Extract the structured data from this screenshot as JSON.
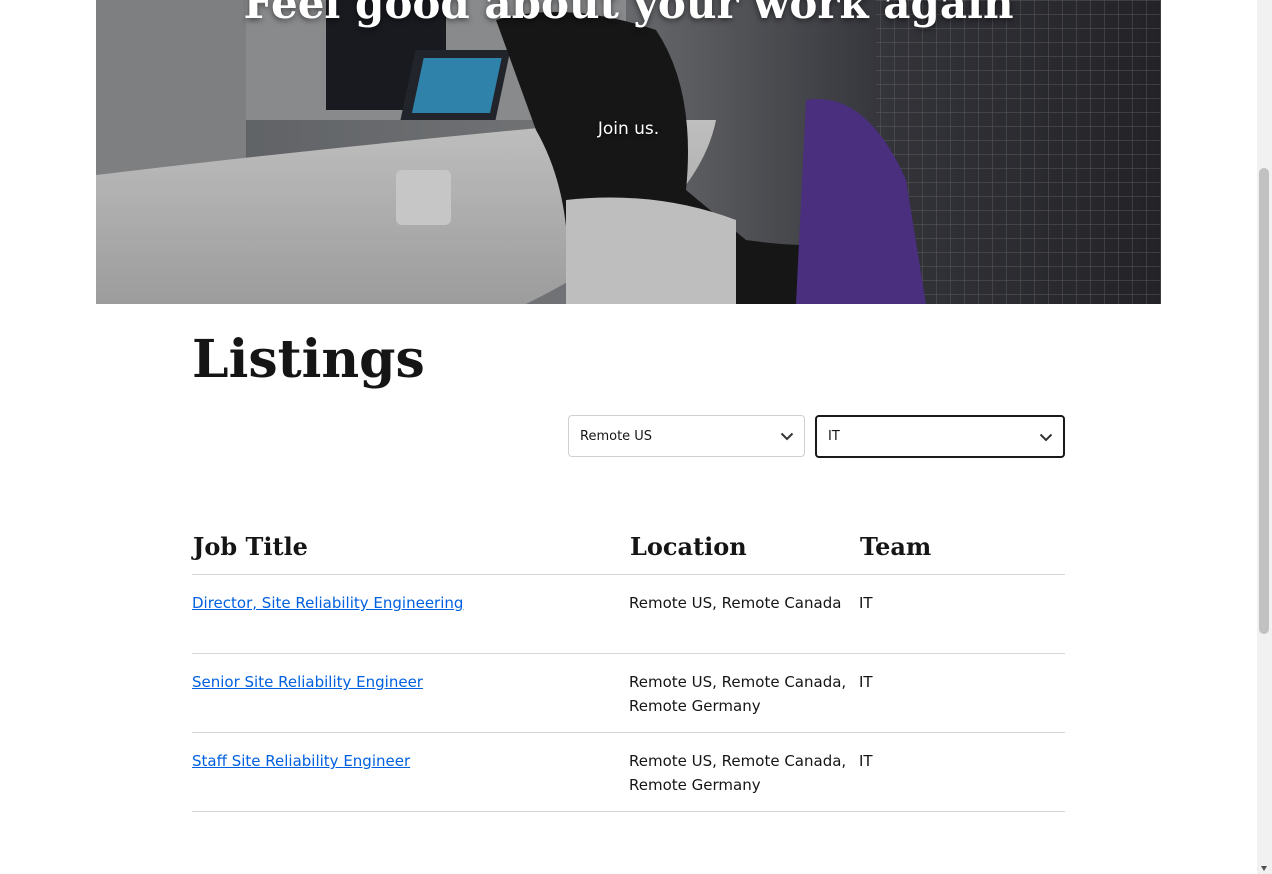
{
  "hero": {
    "title": "Feel good about your work again",
    "subtitle": "Join us."
  },
  "listings": {
    "heading": "Listings",
    "filters": {
      "location": {
        "selected": "Remote US"
      },
      "team": {
        "selected": "IT"
      }
    },
    "columns": [
      "Job Title",
      "Location",
      "Team"
    ],
    "rows": [
      {
        "title": "Director, Site Reliability Engineering",
        "location": "Remote US, Remote Canada",
        "team": "IT"
      },
      {
        "title": "Senior Site Reliability Engineer",
        "location": "Remote US, Remote Canada, Remote Germany",
        "team": "IT"
      },
      {
        "title": "Staff Site Reliability Engineer",
        "location": "Remote US, Remote Canada, Remote Germany",
        "team": "IT"
      }
    ]
  },
  "colors": {
    "link": "#0060df",
    "text": "#151515",
    "divider": "#d6d6d6"
  },
  "icons": {
    "select_chevron": "chevron-down-icon",
    "scroll_arrow": "scroll-down-arrow-icon"
  }
}
